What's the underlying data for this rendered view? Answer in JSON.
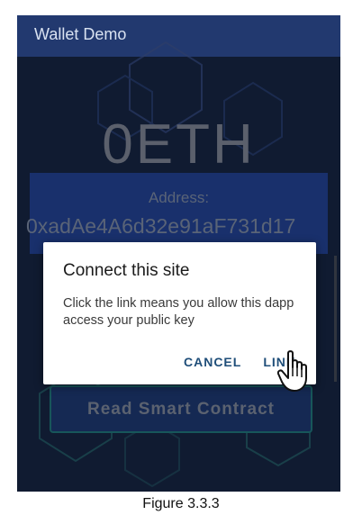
{
  "app": {
    "title": "Wallet Demo"
  },
  "wallet": {
    "balance": "0ETH",
    "address_label": "Address:",
    "address_value": "0xadAe4A6d32e91aF731d17"
  },
  "actions": {
    "read_contract_label": "Read Smart Contract"
  },
  "dialog": {
    "title": "Connect this site",
    "body": "Click the link means you allow this dapp access your public key",
    "cancel_label": "CANCEL",
    "link_label": "LINK"
  },
  "figure": {
    "caption": "Figure 3.3.3"
  },
  "colors": {
    "appbar": "#22396f",
    "background": "#14213c",
    "card": "#1f3b84",
    "dialog_button": "#1f4e79"
  }
}
